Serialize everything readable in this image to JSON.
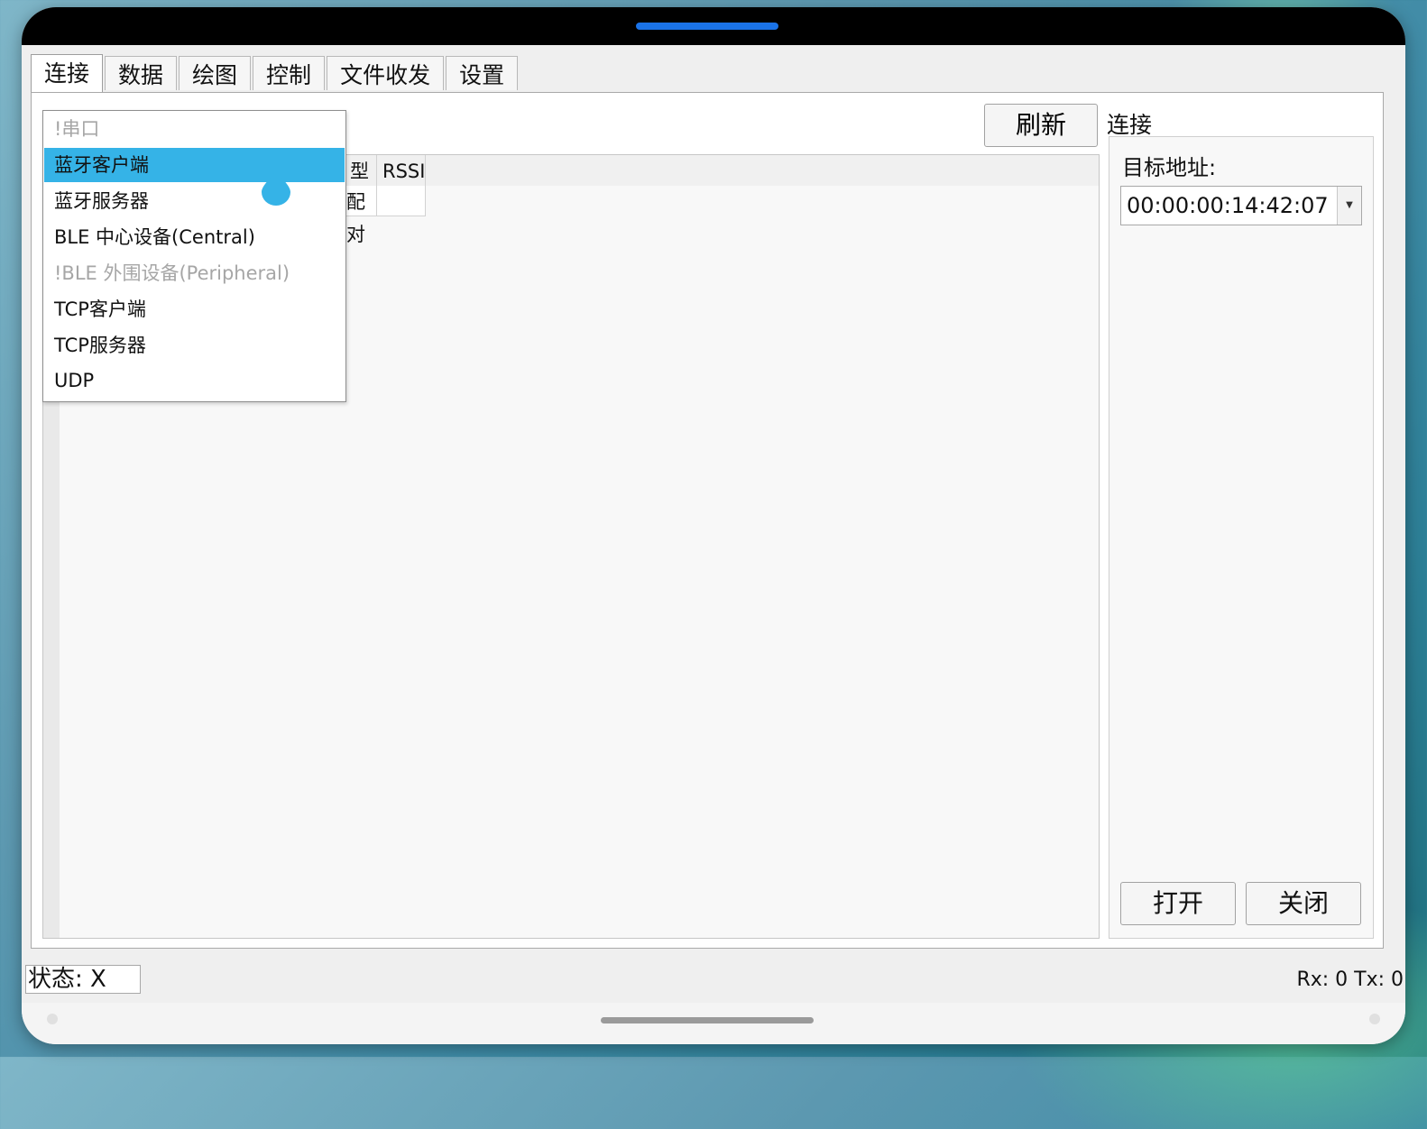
{
  "tabs": [
    "连接",
    "数据",
    "绘图",
    "控制",
    "文件收发",
    "设置"
  ],
  "refresh_label": "刷新",
  "table": {
    "headers": [
      "型",
      "RSSI"
    ],
    "rows": [
      [
        "配对",
        ""
      ]
    ]
  },
  "connection": {
    "title": "连接",
    "address_label": "目标地址:",
    "address_value": "00:00:00:14:42:07",
    "open_label": "打开",
    "close_label": "关闭"
  },
  "status": {
    "text": "状态: X",
    "rxtx": "Rx: 0  Tx: 0"
  },
  "dropdown": {
    "items": [
      {
        "label": "!串口",
        "state": "disabled"
      },
      {
        "label": "蓝牙客户端",
        "state": "selected"
      },
      {
        "label": "蓝牙服务器",
        "state": "normal"
      },
      {
        "label": "BLE 中心设备(Central)",
        "state": "normal"
      },
      {
        "label": "!BLE 外围设备(Peripheral)",
        "state": "disabled"
      },
      {
        "label": "TCP客户端",
        "state": "normal"
      },
      {
        "label": "TCP服务器",
        "state": "normal"
      },
      {
        "label": "UDP",
        "state": "normal"
      }
    ]
  },
  "colors": {
    "accent": "#35b3e7",
    "topbar_pill": "#1a73e8"
  },
  "icons": {
    "touch_indicator": "water-drop-icon",
    "combo_arrow": "chevron-down-icon"
  }
}
